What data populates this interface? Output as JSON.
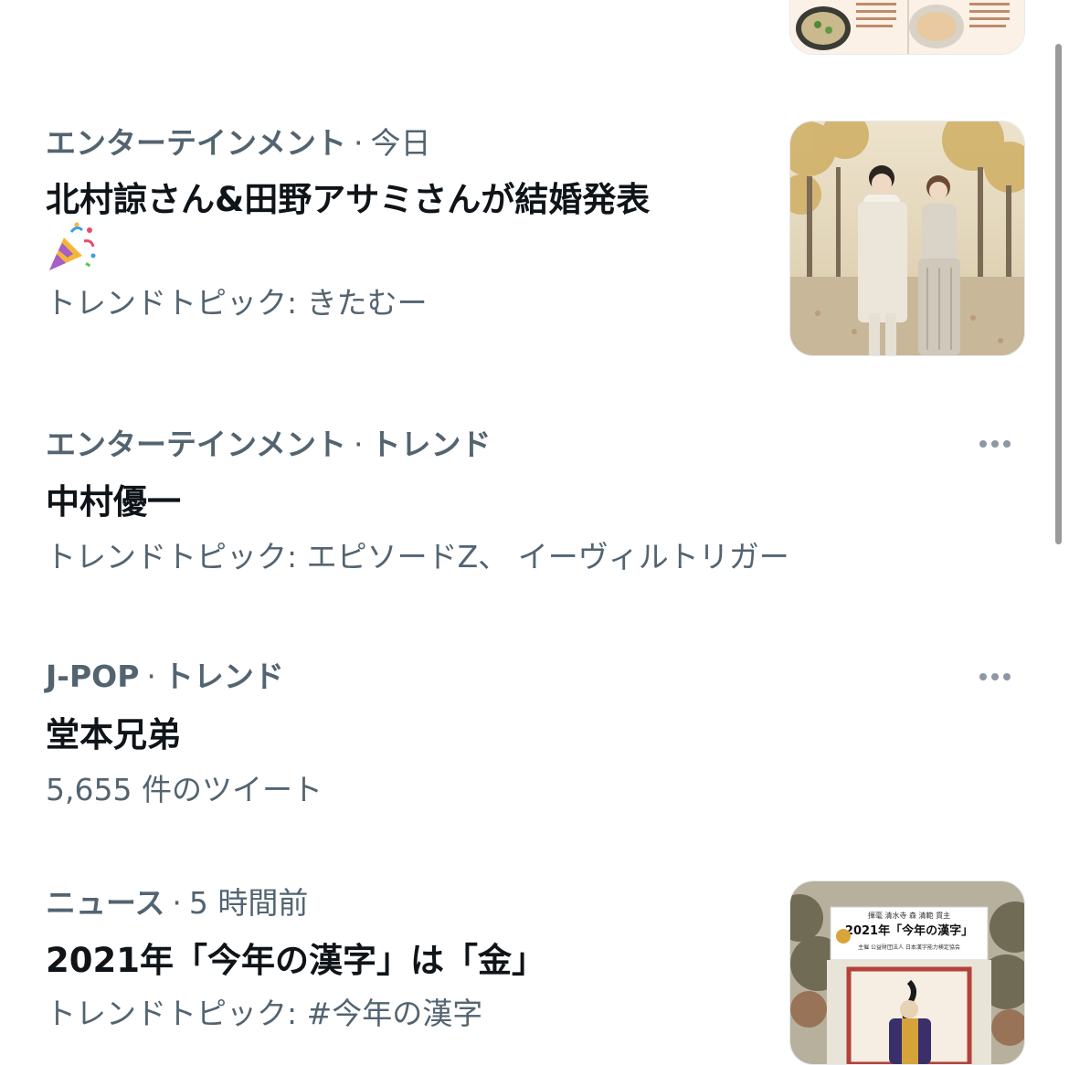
{
  "trends": [
    {
      "category": "エンターテインメント",
      "context": "今日",
      "headline": "北村諒さん&田野アサミさんが結婚発表",
      "emoji": "party-popper",
      "subtitle": "トレンドトピック: きたむー"
    },
    {
      "category": "エンターテインメント",
      "context": "トレンド",
      "headline": "中村優一",
      "subtitle": "トレンドトピック: エピソードZ、 イーヴィルトリガー"
    },
    {
      "category": "J-POP",
      "context": "トレンド",
      "headline": "堂本兄弟",
      "subtitle": "5,655 件のツイート"
    },
    {
      "category": "ニュース",
      "context": "5 時間前",
      "headline": "2021年「今年の漢字」は「金」",
      "subtitle": "トレンドトピック: #今年の漢字"
    }
  ],
  "kanji_thumbnail": {
    "top_line": "揮毫 清水寺 森 清範 貫主",
    "title": "2021年「今年の漢字」",
    "bottom_line": "主催 公益財団法人 日本漢字能力検定協会"
  },
  "colors": {
    "text_primary": "#0f1419",
    "text_secondary": "#536471",
    "dots": "#8b98a5"
  }
}
